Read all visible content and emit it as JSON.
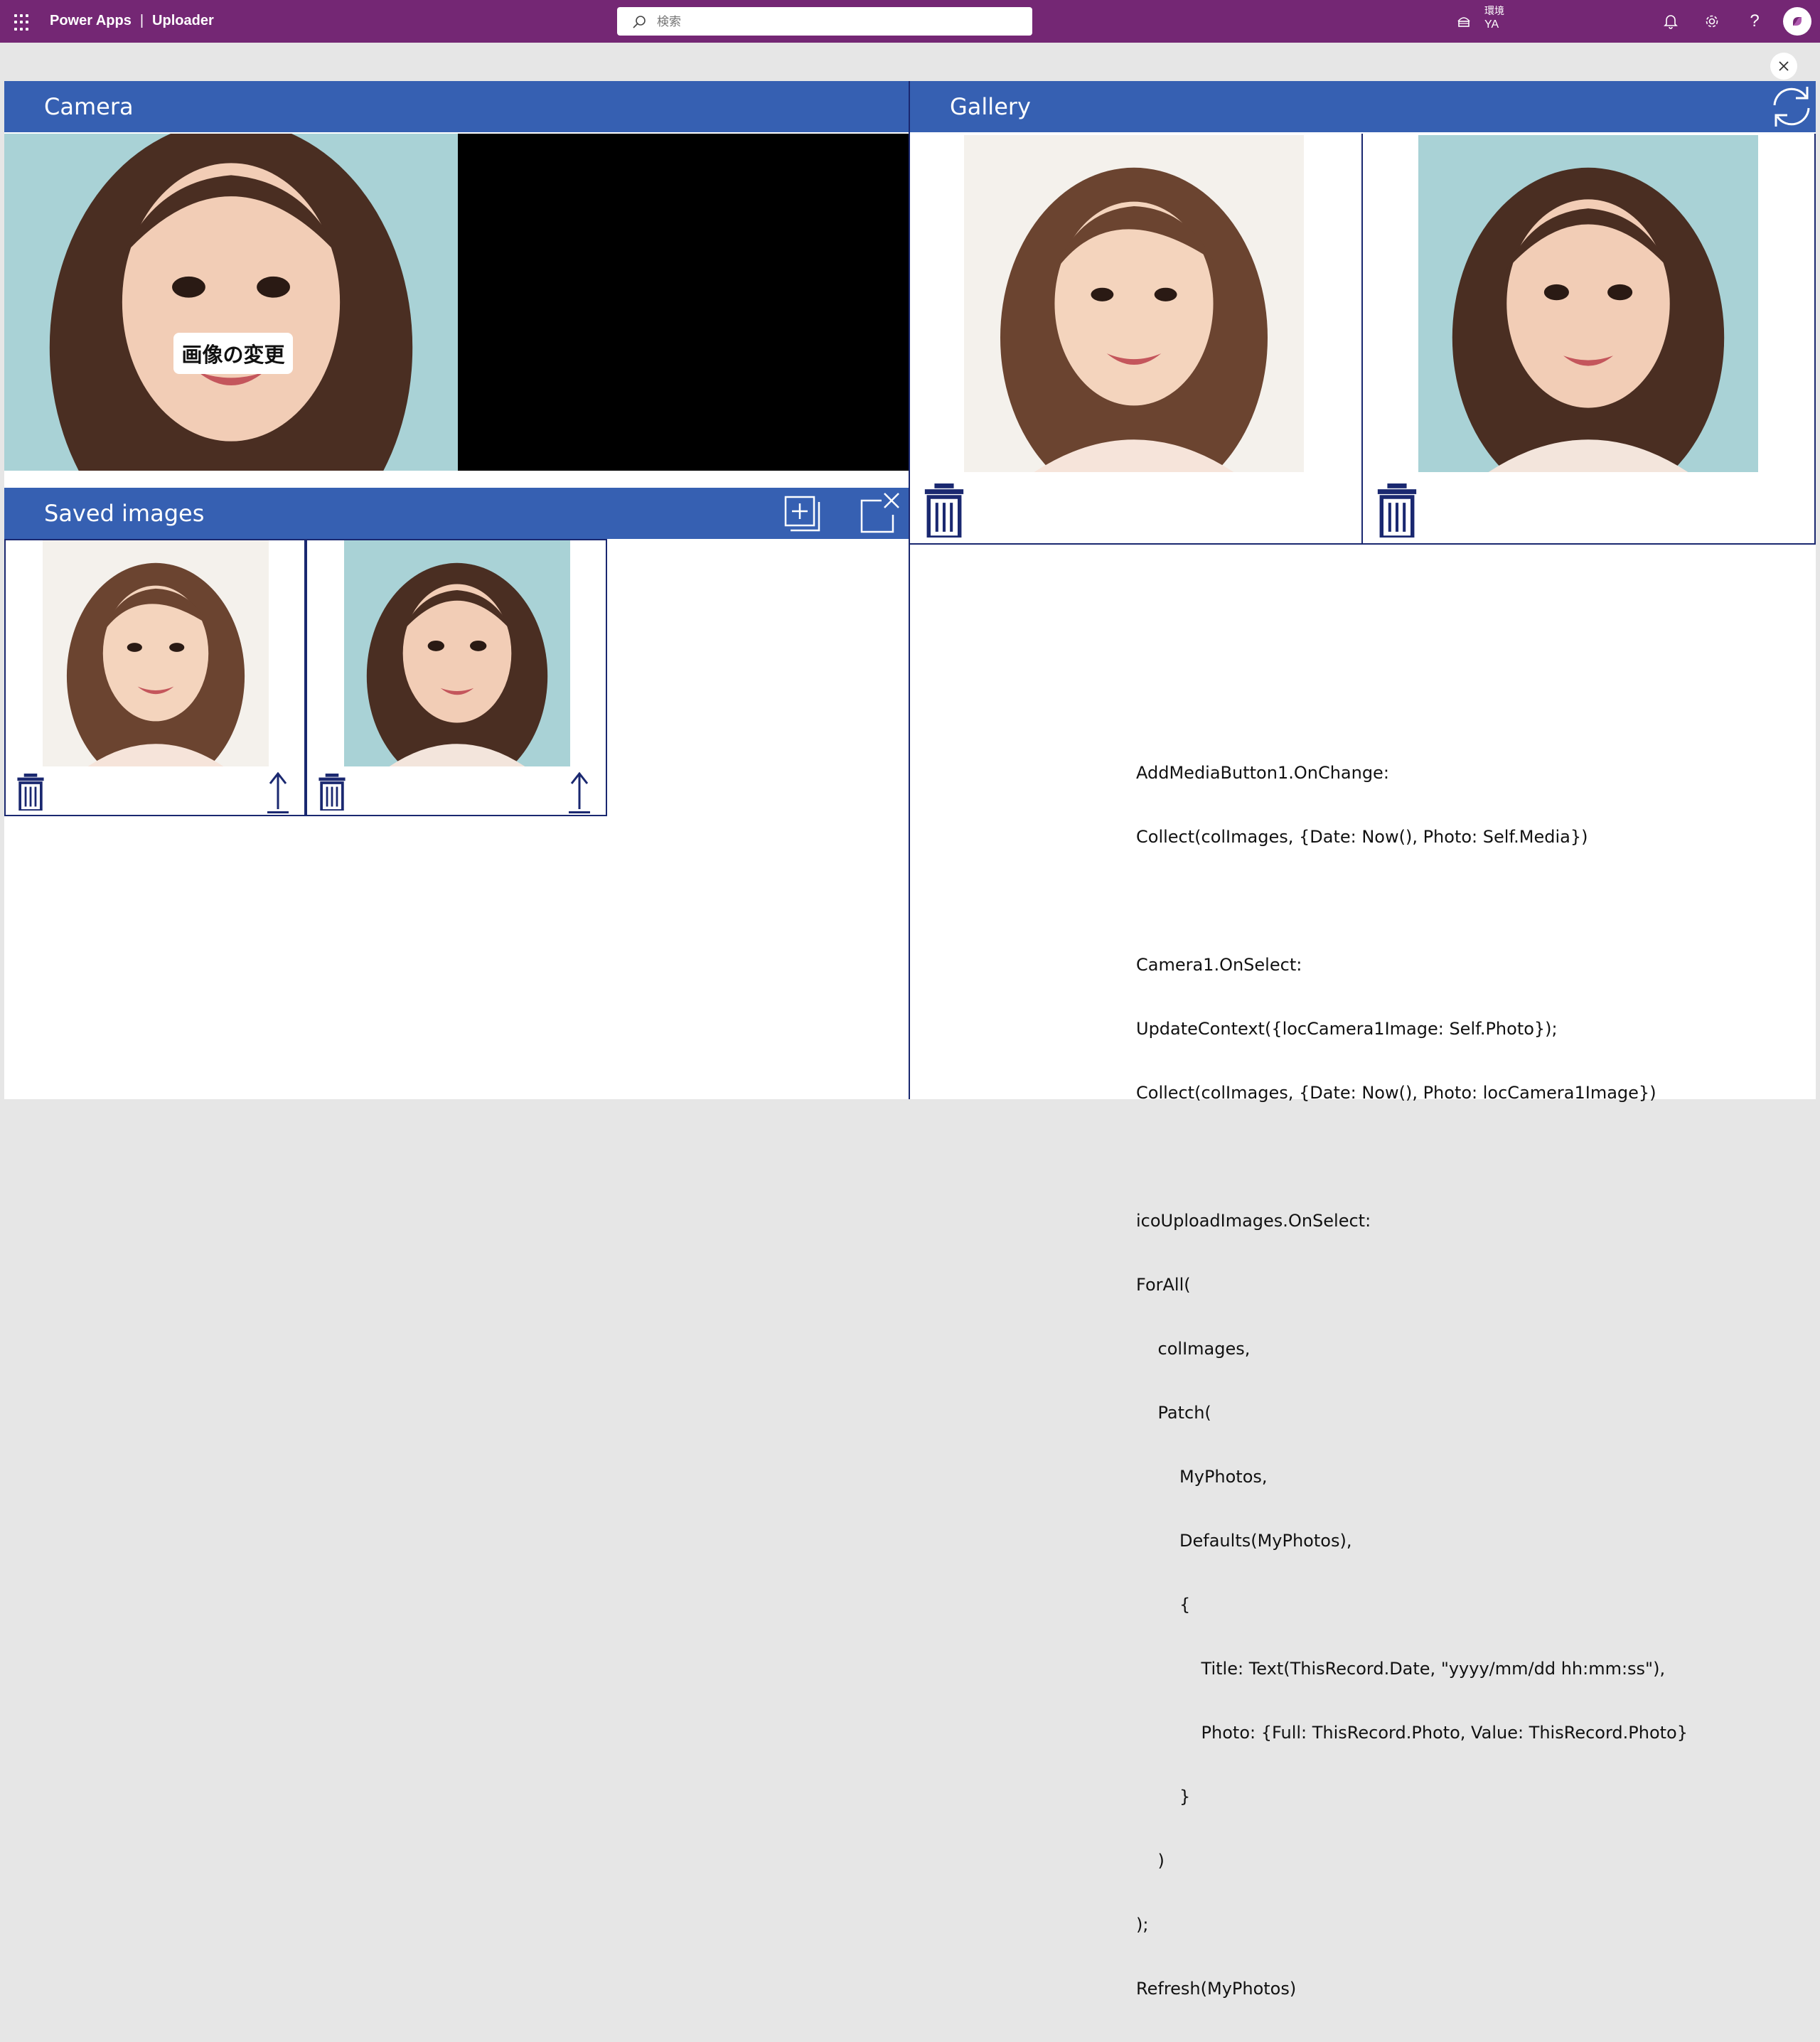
{
  "topbar": {
    "app": "Power Apps",
    "separator": "|",
    "title": "Uploader",
    "search_placeholder": "検索",
    "environment_label": "環境",
    "environment_name": "YA"
  },
  "camera": {
    "title": "Camera",
    "change_image_label": "画像の変更"
  },
  "saved": {
    "title": "Saved images"
  },
  "gallery": {
    "title": "Gallery"
  },
  "colors": {
    "topbar": "#742774",
    "header": "#3660b2",
    "icon": "#1a2870",
    "background": "#e6e6e6"
  },
  "icons": [
    "waffle-icon",
    "search-icon",
    "environment-icon",
    "bell-icon",
    "gear-icon",
    "help-icon",
    "copilot-icon",
    "close-icon",
    "add-media-icon",
    "clear-collection-icon",
    "refresh-icon",
    "trash-icon",
    "upload-arrow-icon"
  ],
  "code": {
    "lines": [
      "AddMediaButton1.OnChange:",
      "Collect(colImages, {Date: Now(), Photo: Self.Media})",
      "",
      "Camera1.OnSelect:",
      "UpdateContext({locCamera1Image: Self.Photo});",
      "Collect(colImages, {Date: Now(), Photo: locCamera1Image})",
      "",
      "icoUploadImages.OnSelect:",
      "ForAll(",
      "    colImages,",
      "    Patch(",
      "        MyPhotos,",
      "        Defaults(MyPhotos),",
      "        {",
      "            Title: Text(ThisRecord.Date, \"yyyy/mm/dd hh:mm:ss\"),",
      "            Photo: {Full: ThisRecord.Photo, Value: ThisRecord.Photo}",
      "        }",
      "    )",
      ");",
      "Refresh(MyPhotos)"
    ]
  }
}
